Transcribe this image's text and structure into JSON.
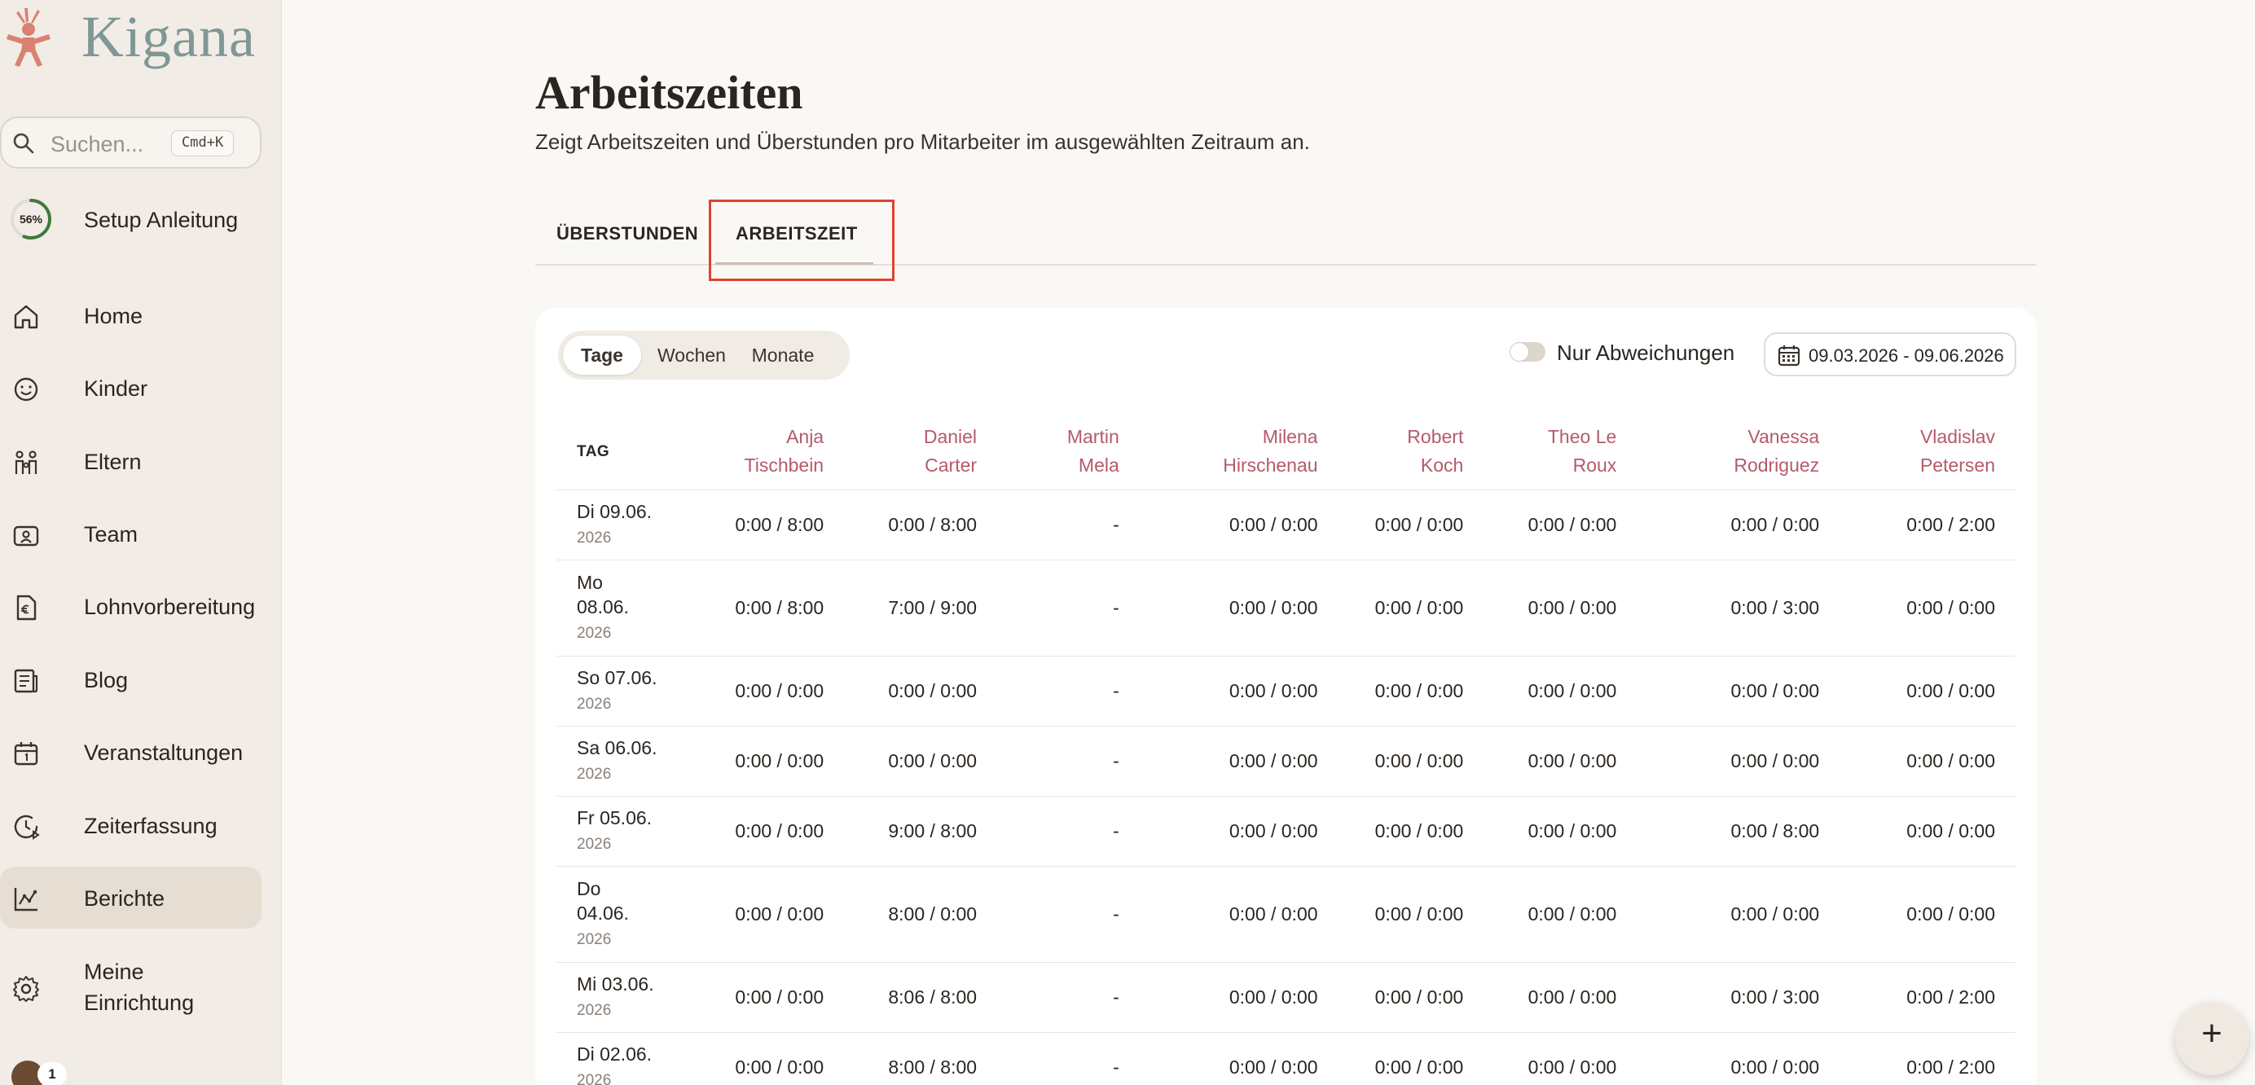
{
  "app": {
    "name": "Kigana"
  },
  "search": {
    "placeholder": "Suchen...",
    "shortcut": "Cmd+K"
  },
  "setup": {
    "percent": "56%",
    "label": "Setup Anleitung",
    "progress": 0.56
  },
  "nav": [
    {
      "label": "Home",
      "icon": "home-icon"
    },
    {
      "label": "Kinder",
      "icon": "smiley-icon"
    },
    {
      "label": "Eltern",
      "icon": "family-icon"
    },
    {
      "label": "Team",
      "icon": "badge-icon"
    },
    {
      "label": "Lohnvorbereitung",
      "icon": "euro-document-icon"
    },
    {
      "label": "Blog",
      "icon": "newspaper-icon"
    },
    {
      "label": "Veranstaltungen",
      "icon": "calendar-icon"
    },
    {
      "label": "Zeiterfassung",
      "icon": "clock-icon"
    },
    {
      "label": "Berichte",
      "icon": "chart-icon",
      "active": true
    },
    {
      "label_line1": "Meine",
      "label_line2": "Einrichtung",
      "icon": "gear-icon"
    }
  ],
  "notifications": {
    "count": "1"
  },
  "page": {
    "title": "Arbeitszeiten",
    "subtitle": "Zeigt Arbeitszeiten und Überstunden pro Mitarbeiter im ausgewählten Zeitraum an."
  },
  "tabs": {
    "overtime": "ÜBERSTUNDEN",
    "worktime": "ARBEITSZEIT"
  },
  "granularity": {
    "days": "Tage",
    "weeks": "Wochen",
    "months": "Monate"
  },
  "filter": {
    "deviations_label": "Nur Abweichungen",
    "date_range": "09.03.2026 - 09.06.2026"
  },
  "table": {
    "day_header": "TAG",
    "employees": [
      {
        "first": "Anja",
        "last": "Tischbein"
      },
      {
        "first": "Daniel",
        "last": "Carter"
      },
      {
        "first": "Martin",
        "last": "Mela"
      },
      {
        "first": "Milena",
        "last": "Hirschenau"
      },
      {
        "first": "Robert",
        "last": "Koch"
      },
      {
        "first": "Theo Le",
        "last": "Roux"
      },
      {
        "first": "Vanessa",
        "last": "Rodriguez"
      },
      {
        "first": "Vladislav",
        "last": "Petersen"
      }
    ],
    "rows": [
      {
        "day": "Di 09.06.",
        "year": "2026",
        "cells": [
          "0:00 / 8:00",
          "0:00 / 8:00",
          "-",
          "0:00 / 0:00",
          "0:00 / 0:00",
          "0:00 / 0:00",
          "0:00 / 0:00",
          "0:00 / 2:00"
        ]
      },
      {
        "day_line1": "Mo",
        "day_line2": "08.06.",
        "year": "2026",
        "cells": [
          "0:00 / 8:00",
          "7:00 / 9:00",
          "-",
          "0:00 / 0:00",
          "0:00 / 0:00",
          "0:00 / 0:00",
          "0:00 / 3:00",
          "0:00 / 0:00"
        ]
      },
      {
        "day": "So 07.06.",
        "year": "2026",
        "cells": [
          "0:00 / 0:00",
          "0:00 / 0:00",
          "-",
          "0:00 / 0:00",
          "0:00 / 0:00",
          "0:00 / 0:00",
          "0:00 / 0:00",
          "0:00 / 0:00"
        ]
      },
      {
        "day": "Sa 06.06.",
        "year": "2026",
        "cells": [
          "0:00 / 0:00",
          "0:00 / 0:00",
          "-",
          "0:00 / 0:00",
          "0:00 / 0:00",
          "0:00 / 0:00",
          "0:00 / 0:00",
          "0:00 / 0:00"
        ]
      },
      {
        "day": "Fr 05.06.",
        "year": "2026",
        "cells": [
          "0:00 / 0:00",
          "9:00 / 8:00",
          "-",
          "0:00 / 0:00",
          "0:00 / 0:00",
          "0:00 / 0:00",
          "0:00 / 8:00",
          "0:00 / 0:00"
        ]
      },
      {
        "day_line1": "Do",
        "day_line2": "04.06.",
        "year": "2026",
        "cells": [
          "0:00 / 0:00",
          "8:00 / 0:00",
          "-",
          "0:00 / 0:00",
          "0:00 / 0:00",
          "0:00 / 0:00",
          "0:00 / 0:00",
          "0:00 / 0:00"
        ]
      },
      {
        "day": "Mi 03.06.",
        "year": "2026",
        "cells": [
          "0:00 / 0:00",
          "8:06 / 8:00",
          "-",
          "0:00 / 0:00",
          "0:00 / 0:00",
          "0:00 / 0:00",
          "0:00 / 3:00",
          "0:00 / 2:00"
        ]
      },
      {
        "day": "Di 02.06.",
        "year": "2026",
        "cells": [
          "0:00 / 0:00",
          "8:00 / 8:00",
          "-",
          "0:00 / 0:00",
          "0:00 / 0:00",
          "0:00 / 0:00",
          "0:00 / 0:00",
          "0:00 / 2:00"
        ]
      }
    ]
  },
  "fab": {
    "label": "+"
  },
  "colors": {
    "accent_name": "#b55a6b",
    "logo": "#7f9796",
    "highlight": "#e0412f",
    "progress": "#3f7a3a"
  }
}
